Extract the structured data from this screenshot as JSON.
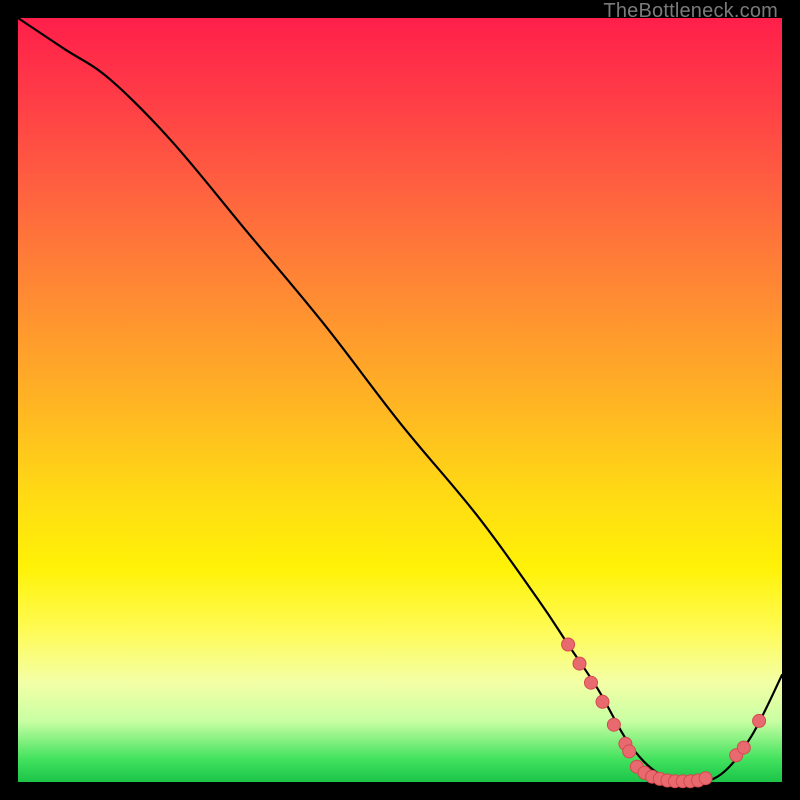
{
  "watermark": "TheBottleneck.com",
  "chart_data": {
    "type": "line",
    "title": "",
    "xlabel": "",
    "ylabel": "",
    "xlim": [
      0,
      100
    ],
    "ylim": [
      0,
      100
    ],
    "series": [
      {
        "name": "bottleneck-curve",
        "x": [
          0,
          6,
          12,
          20,
          30,
          40,
          50,
          60,
          68,
          72,
          76,
          80,
          84,
          88,
          92,
          96,
          100
        ],
        "y": [
          100,
          96,
          92,
          84,
          72,
          60,
          47,
          35,
          24,
          18,
          12,
          5,
          1,
          0,
          1,
          6,
          14
        ]
      }
    ],
    "markers": [
      {
        "x": 72.0,
        "y": 18.0
      },
      {
        "x": 73.5,
        "y": 15.5
      },
      {
        "x": 75.0,
        "y": 13.0
      },
      {
        "x": 76.5,
        "y": 10.5
      },
      {
        "x": 78.0,
        "y": 7.5
      },
      {
        "x": 79.5,
        "y": 5.0
      },
      {
        "x": 80.0,
        "y": 4.0
      },
      {
        "x": 81.0,
        "y": 2.0
      },
      {
        "x": 82.0,
        "y": 1.2
      },
      {
        "x": 83.0,
        "y": 0.7
      },
      {
        "x": 84.0,
        "y": 0.4
      },
      {
        "x": 85.0,
        "y": 0.2
      },
      {
        "x": 86.0,
        "y": 0.1
      },
      {
        "x": 87.0,
        "y": 0.1
      },
      {
        "x": 88.0,
        "y": 0.1
      },
      {
        "x": 89.0,
        "y": 0.2
      },
      {
        "x": 90.0,
        "y": 0.5
      },
      {
        "x": 94.0,
        "y": 3.5
      },
      {
        "x": 95.0,
        "y": 4.5
      },
      {
        "x": 97.0,
        "y": 8.0
      }
    ],
    "colors": {
      "curve": "#000000",
      "marker_fill": "#e86a6f",
      "marker_stroke": "#d34a50"
    }
  }
}
